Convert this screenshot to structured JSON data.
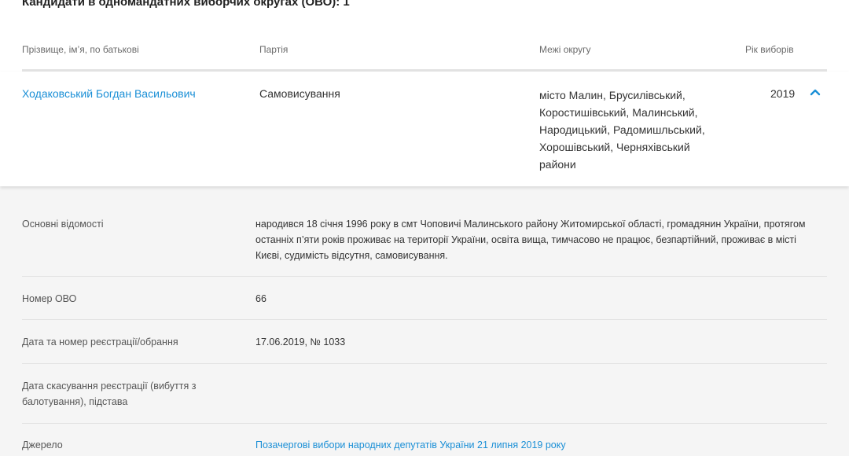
{
  "section": {
    "title": "Кандидати в одномандатних виборчих округах (ОВО): 1"
  },
  "table": {
    "columns": {
      "name": "Прізвище, ім’я, по батькові",
      "party": "Партія",
      "bounds": "Межі округу",
      "year": "Рік виборів"
    }
  },
  "candidate": {
    "name": "Ходаковський Богдан Васильович",
    "party": "Самовисування",
    "bounds": "місто Малин, Брусилівський, Коростишівський, Малинський, Народицький, Радомишльський, Хорошівський, Черняхівський райони",
    "year": "2019",
    "toggle_icon": "chevron-up-icon"
  },
  "details": {
    "basic": {
      "label": "Основні відомості",
      "value": "народився 18 січня 1996 року в смт Чоповичі Малинського району Житомирської області, громадянин України, протягом останніх п’яти років проживає на території України, освіта вища, тимчасово не працює, безпартійний, проживає в місті Києві, судимість відсутня, самовисування."
    },
    "district": {
      "label": "Номер ОВО",
      "value": "66"
    },
    "registration": {
      "label": "Дата та номер реєстрації/обрання",
      "value": "17.06.2019, № 1033"
    },
    "cancellation": {
      "label": "Дата скасування реєстрації (вибуття з балотування), підстава",
      "value": ""
    },
    "source": {
      "label": "Джерело",
      "value": "Позачергові вибори народних депутатів України 21 липня 2019 року"
    }
  },
  "colors": {
    "link": "#1a8fd6",
    "details_bg": "#f5f5f5"
  }
}
